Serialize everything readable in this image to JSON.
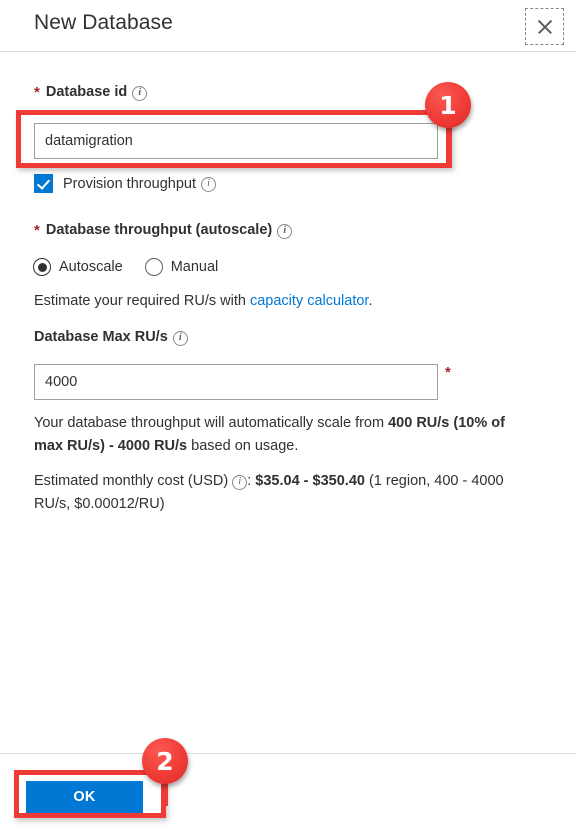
{
  "header": {
    "title": "New Database",
    "close_label": "Close",
    "close_icon": "close-icon"
  },
  "form": {
    "database_id": {
      "label": "Database id",
      "required_marker": "*",
      "info_icon": "info-icon",
      "value": "datamigration",
      "placeholder": ""
    },
    "provision_throughput": {
      "label": "Provision throughput",
      "checked": true,
      "info_icon": "info-icon"
    },
    "database_throughput": {
      "label": "Database throughput (autoscale)",
      "required_marker": "*",
      "info_icon": "info-icon",
      "options": [
        {
          "label": "Autoscale",
          "selected": true
        },
        {
          "label": "Manual",
          "selected": false
        }
      ]
    },
    "estimate_hint": {
      "prefix": "Estimate your required RU/s with ",
      "link_text": "capacity calculator",
      "suffix": "."
    },
    "max_ru": {
      "label": "Database Max RU/s",
      "info_icon": "info-icon",
      "value": "4000",
      "required_marker": "*"
    },
    "scale_note": {
      "part1": "Your database throughput will automatically scale from ",
      "bold1": "400 RU/s (10% of max RU/s) - 4000 RU/s",
      "part2": " based on usage."
    },
    "cost_note": {
      "label": "Estimated monthly cost (USD)",
      "info_icon": "info-icon",
      "separator": ": ",
      "amount": "$35.04 - $350.40",
      "detail": " (1 region, 400 - 4000 RU/s, $0.00012/RU)"
    }
  },
  "footer": {
    "ok_label": "OK"
  },
  "annotations": {
    "badge1": "1",
    "badge2": "2",
    "highlight_color": "#f03a36"
  }
}
